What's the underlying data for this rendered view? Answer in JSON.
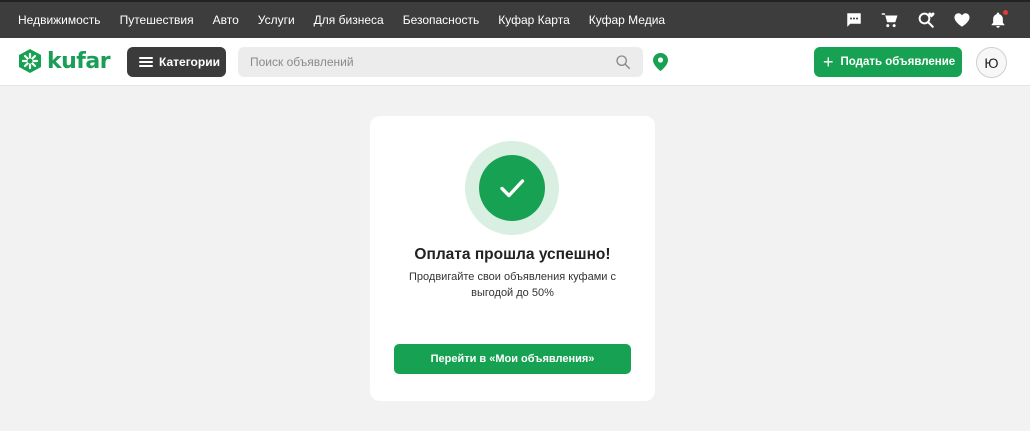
{
  "topnav": {
    "items": [
      "Недвижимость",
      "Путешествия",
      "Авто",
      "Услуги",
      "Для бизнеса",
      "Безопасность",
      "Куфар Карта",
      "Куфар Медиа"
    ]
  },
  "topicons": [
    "messages-icon",
    "cart-icon",
    "saved-search-icon",
    "favorites-heart-icon",
    "notifications-bell-icon"
  ],
  "header": {
    "logo_text": "kufar",
    "categories_label": "Категории",
    "search_placeholder": "Поиск объявлений",
    "post_ad_label": "Подать объявление",
    "avatar_initial": "Ю"
  },
  "card": {
    "title": "Оплата прошла успешно!",
    "subtitle": "Продвигайте свои объявления куфами с выгодой до 50%",
    "button_label": "Перейти в «Мои объявления»"
  },
  "colors": {
    "brand_green": "#17a152",
    "topbar_bg": "#3d3d3d",
    "notification_dot": "#e53935",
    "success_ring": "#d9efe1"
  }
}
